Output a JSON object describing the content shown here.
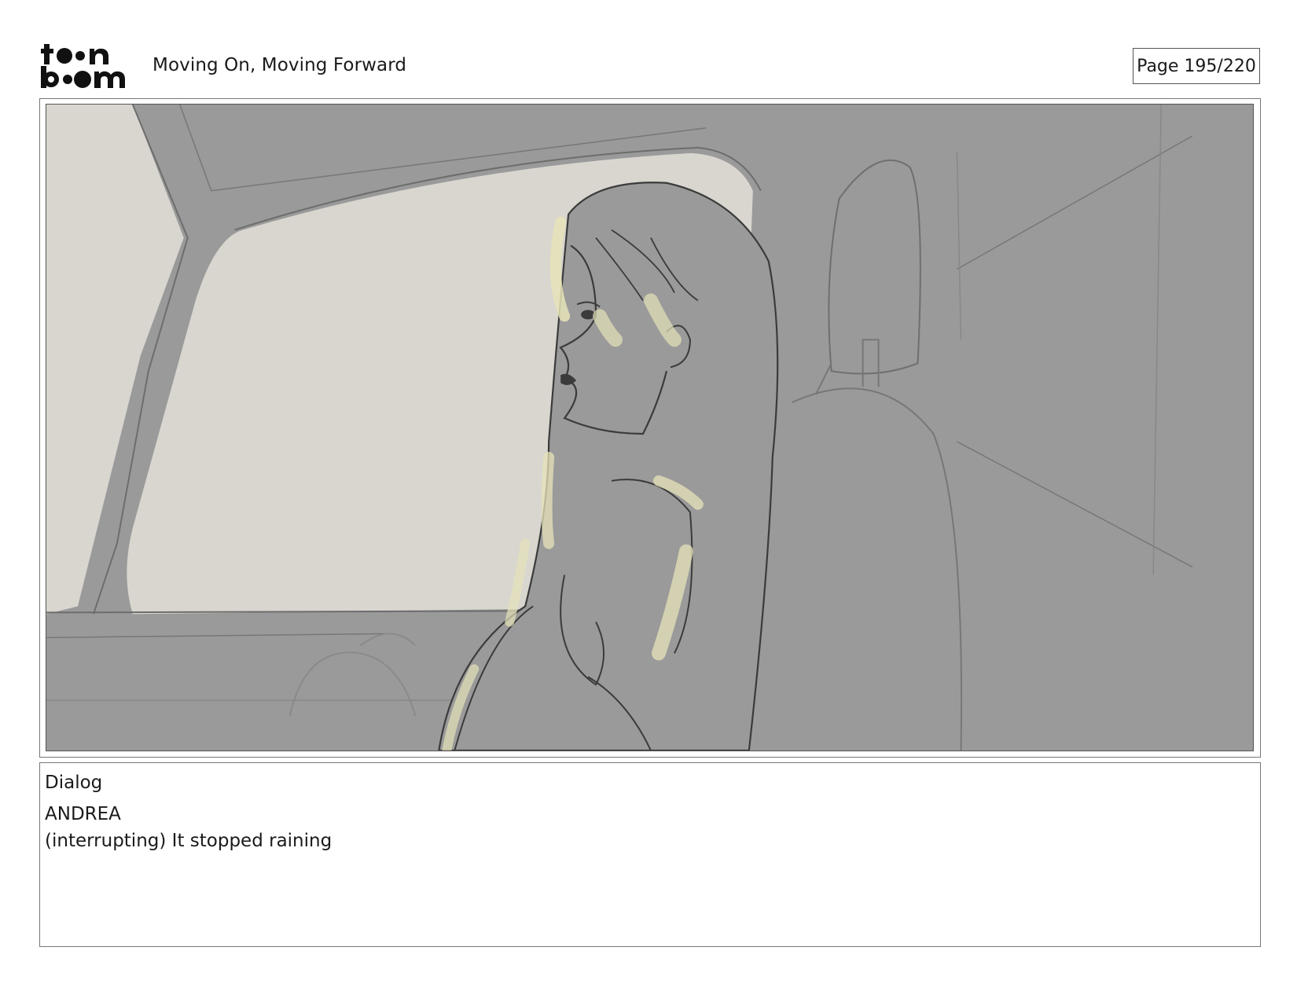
{
  "header": {
    "logo_text": "toon boom",
    "title": "Moving On, Moving Forward",
    "page_label": "Page 195/220"
  },
  "panel": {
    "icon": "storyboard-drawing"
  },
  "dialog": {
    "heading": "Dialog",
    "speaker": "ANDREA",
    "line": "(interrupting) It stopped raining"
  },
  "colors": {
    "frame_border": "#777777",
    "sketch_gray": "#9a9a9a",
    "window_light": "#d8d6cf",
    "highlight": "#e6e3b8"
  }
}
